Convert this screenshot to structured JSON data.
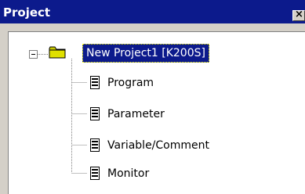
{
  "window": {
    "title": "Project",
    "close_glyph": "×"
  },
  "tree": {
    "root": {
      "label": "New Project1 [K200S]",
      "icon": "folder-icon",
      "expanded": true,
      "selected": true
    },
    "children": [
      {
        "label": "Program",
        "icon": "document-icon"
      },
      {
        "label": "Parameter",
        "icon": "document-icon"
      },
      {
        "label": "Variable/Comment",
        "icon": "document-icon"
      },
      {
        "label": "Monitor",
        "icon": "document-icon"
      }
    ]
  },
  "colors": {
    "titlebar": "#0c1a8c",
    "selection": "#0c1a8c",
    "folder": "#c8c800"
  }
}
